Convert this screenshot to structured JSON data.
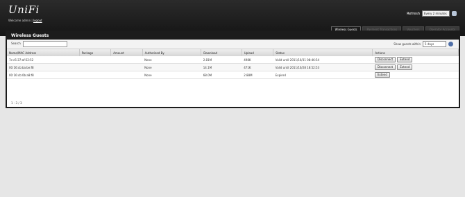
{
  "app": {
    "logo": "UniFi"
  },
  "header": {
    "welcome": "Welcome admin",
    "logout": "logout",
    "refresh_label": "Refresh",
    "refresh_value": "Every 2 minutes"
  },
  "tabs": [
    {
      "label": "Wireless Guests"
    },
    {
      "label": "Payment Transactions"
    },
    {
      "label": "Vouchers"
    },
    {
      "label": "Operator Accounts"
    }
  ],
  "panel": {
    "title": "Wireless Guests",
    "search_label": "Search",
    "show_label": "Show guests within",
    "show_value": "5 days",
    "columns": [
      "Name/MAC Address",
      "Package",
      "Amount",
      "Authorized By",
      "Download",
      "Upload",
      "Status",
      "Actions"
    ],
    "rows": [
      {
        "name": "7c:c5:37:af:52:52",
        "package": "",
        "amount": "",
        "auth": "None",
        "download": "2.81M",
        "upload": "498K",
        "status": "Valid until 2011/10/31 08:46:54",
        "actions": [
          "Disconnect",
          "Extend"
        ]
      },
      {
        "name": "00:16:cb:ba:be:f8",
        "package": "",
        "amount": "",
        "auth": "None",
        "download": "14.1M",
        "upload": "471K",
        "status": "Valid until 2011/10/28 18:52:53",
        "actions": [
          "Disconnect",
          "Extend"
        ]
      },
      {
        "name": "00:16:cb:0b:a8:f8",
        "package": "",
        "amount": "",
        "auth": "None",
        "download": "68.0M",
        "upload": "2.88M",
        "status": "Expired",
        "actions": [
          "Extend"
        ]
      }
    ],
    "footer": "1 - 3 / 3"
  }
}
